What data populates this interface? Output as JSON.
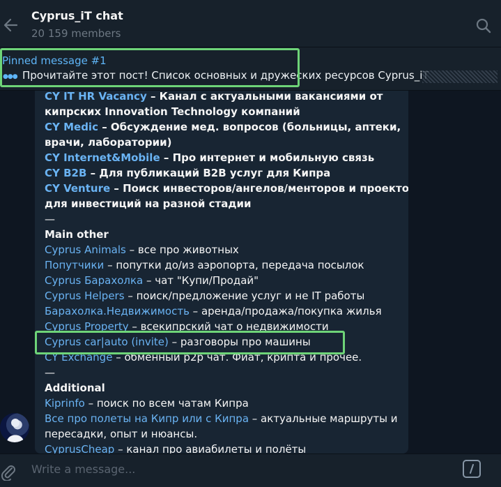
{
  "header": {
    "title": "Cyprus_iT chat",
    "members": "20 159 members"
  },
  "pinned": {
    "title": "Pinned message #1",
    "text": "Прочитайте этот пост!  Список основных и дружеских ресурсов Cyprus_iT"
  },
  "message": {
    "lines": [
      [
        {
          "t": "CY IT HR Vacancy",
          "link": true,
          "bold": true
        },
        {
          "t": " – Канал с актуальными вакансиями от",
          "bold": true
        }
      ],
      [
        {
          "t": "кипрских Innovation Technology компаний",
          "bold": true
        }
      ],
      [
        {
          "t": "CY Medic",
          "link": true,
          "bold": true
        },
        {
          "t": " – Обсуждение мед. вопросов (больницы, аптеки,",
          "bold": true
        }
      ],
      [
        {
          "t": "врачи, лаборатории)",
          "bold": true
        }
      ],
      [
        {
          "t": "CY Internet&Mobile",
          "link": true,
          "bold": true
        },
        {
          "t": " – Про интернет и мобильную связь",
          "bold": true
        }
      ],
      [
        {
          "t": "CY B2B",
          "link": true,
          "bold": true
        },
        {
          "t": " – Для публикаций B2B услуг для Кипра",
          "bold": true
        }
      ],
      [
        {
          "t": "CY Venture",
          "link": true,
          "bold": true
        },
        {
          "t": " – Поиск инвесторов/ангелов/менторов и проектов",
          "bold": true
        }
      ],
      [
        {
          "t": "для инвестиций на разной стадии",
          "bold": true
        }
      ],
      [
        {
          "t": "—"
        }
      ],
      [
        {
          "t": "Main other",
          "bold": true
        }
      ],
      [
        {
          "t": "Cyprus Animals",
          "link": true
        },
        {
          "t": " – все про животных"
        }
      ],
      [
        {
          "t": "Попутчики",
          "link": true
        },
        {
          "t": " – попутки до/из аэропорта, передача посылок"
        }
      ],
      [
        {
          "t": "Cyprus Барахолка",
          "link": true
        },
        {
          "t": " – чат \"Купи/Продай\""
        }
      ],
      [
        {
          "t": "Cyprus Helpers",
          "link": true
        },
        {
          "t": " – поиск/предложение услуг и не IT работы"
        }
      ],
      [
        {
          "t": "Барахолка.Недвижимость",
          "link": true
        },
        {
          "t": " – аренда/продажа/покупка жилья"
        }
      ],
      [
        {
          "t": "Cyprus Property",
          "link": true
        },
        {
          "t": " – всекипрский чат о недвижимости"
        }
      ],
      [
        {
          "t": "Cyprus car|auto (invite)",
          "link": true
        },
        {
          "t": " – разговоры про машины"
        }
      ],
      [
        {
          "t": "CY Exchange",
          "link": true
        },
        {
          "t": " – обменный p2p чат. Фиат, крипта и прочее."
        }
      ],
      [
        {
          "t": "—"
        }
      ],
      [
        {
          "t": "Additional",
          "bold": true
        }
      ],
      [
        {
          "t": "Kiprinfo",
          "link": true
        },
        {
          "t": " – поиск по всем чатам Кипра"
        }
      ],
      [
        {
          "t": "Все про полеты на Кипр или с Кипра",
          "link": true
        },
        {
          "t": " – актуальные маршруты и"
        }
      ],
      [
        {
          "t": "пересадки, опыт и нюансы."
        }
      ],
      [
        {
          "t": "CyprusCheap",
          "link": true
        },
        {
          "t": " – канал про авиабилеты и полёты"
        }
      ]
    ]
  },
  "composer": {
    "placeholder": "Write a message..."
  }
}
